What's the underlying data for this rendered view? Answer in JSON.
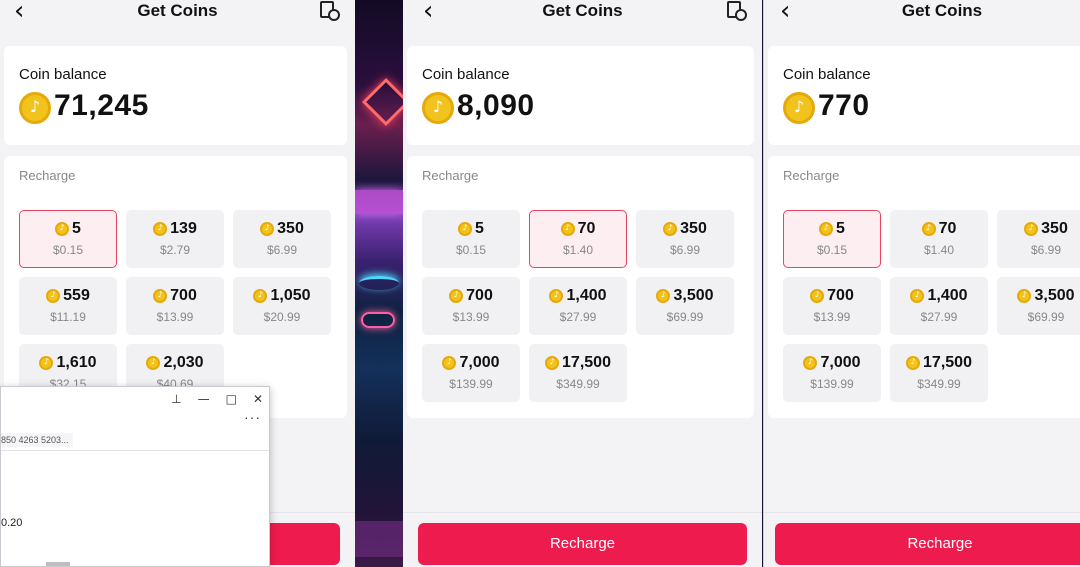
{
  "neon_decor": {
    "sign_text": "((○))"
  },
  "panels": [
    {
      "id": "p1",
      "title": "Get Coins",
      "balance_label": "Coin balance",
      "balance": "71,245",
      "recharge_label": "Recharge",
      "options": [
        {
          "amount": "5",
          "price": "$0.15",
          "selected": true
        },
        {
          "amount": "139",
          "price": "$2.79",
          "selected": false
        },
        {
          "amount": "350",
          "price": "$6.99",
          "selected": false
        },
        {
          "amount": "559",
          "price": "$11.19",
          "selected": false
        },
        {
          "amount": "700",
          "price": "$13.99",
          "selected": false
        },
        {
          "amount": "1,050",
          "price": "$20.99",
          "selected": false
        },
        {
          "amount": "1,610",
          "price": "$32.15",
          "selected": false
        },
        {
          "amount": "2,030",
          "price": "$40.69",
          "selected": false
        }
      ],
      "button": ""
    },
    {
      "id": "p2",
      "title": "Get Coins",
      "balance_label": "Coin balance",
      "balance": "8,090",
      "recharge_label": "Recharge",
      "options": [
        {
          "amount": "5",
          "price": "$0.15",
          "selected": false
        },
        {
          "amount": "70",
          "price": "$1.40",
          "selected": true
        },
        {
          "amount": "350",
          "price": "$6.99",
          "selected": false
        },
        {
          "amount": "700",
          "price": "$13.99",
          "selected": false
        },
        {
          "amount": "1,400",
          "price": "$27.99",
          "selected": false
        },
        {
          "amount": "3,500",
          "price": "$69.99",
          "selected": false
        },
        {
          "amount": "7,000",
          "price": "$139.99",
          "selected": false
        },
        {
          "amount": "17,500",
          "price": "$349.99",
          "selected": false
        }
      ],
      "button": "Recharge"
    },
    {
      "id": "p3",
      "title": "Get Coins",
      "balance_label": "Coin balance",
      "balance": "770",
      "recharge_label": "Recharge",
      "options": [
        {
          "amount": "5",
          "price": "$0.15",
          "selected": true
        },
        {
          "amount": "70",
          "price": "$1.40",
          "selected": false
        },
        {
          "amount": "350",
          "price": "$6.99",
          "selected": false
        },
        {
          "amount": "700",
          "price": "$13.99",
          "selected": false
        },
        {
          "amount": "1,400",
          "price": "$27.99",
          "selected": false
        },
        {
          "amount": "3,500",
          "price": "$69.99",
          "selected": false
        },
        {
          "amount": "7,000",
          "price": "$139.99",
          "selected": false
        },
        {
          "amount": "17,500",
          "price": "$349.99",
          "selected": false
        }
      ],
      "button": "Recharge"
    }
  ],
  "overlay_window": {
    "controls": [
      "pin-icon",
      "minimize-icon",
      "maximize-icon",
      "close-icon"
    ],
    "more": "···",
    "text_number": "850 4263 5203...",
    "text_amount": "0.20"
  },
  "icons": {
    "back": "back-chevron-icon",
    "history": "history-icon",
    "coin": "coin-icon"
  },
  "colors": {
    "accent": "#ee1c4e",
    "selected_border": "#e8435f",
    "selected_bg": "#fdeef1",
    "coin": "#f2c31c"
  }
}
